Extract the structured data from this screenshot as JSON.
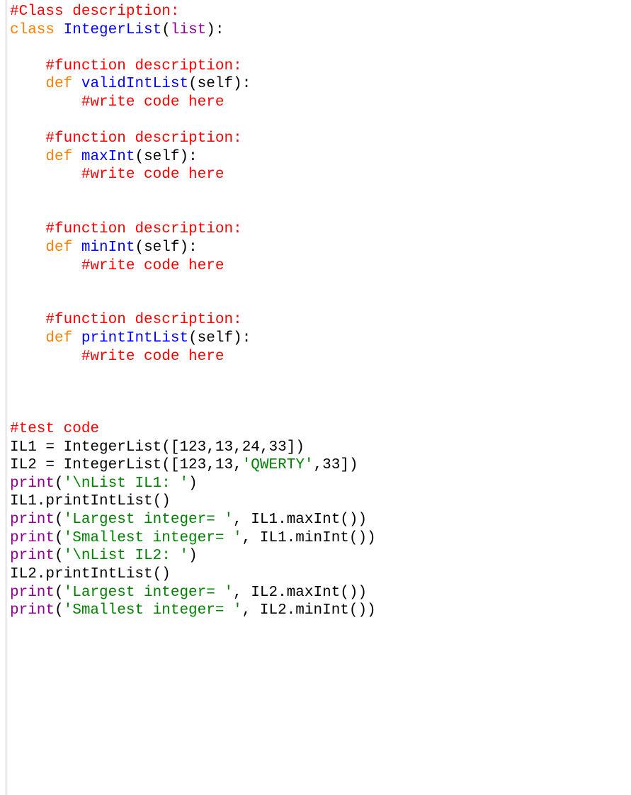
{
  "lines": [
    {
      "tokens": [
        {
          "cls": "c-red",
          "t": "#Class description:"
        }
      ]
    },
    {
      "tokens": [
        {
          "cls": "c-orange",
          "t": "class"
        },
        {
          "cls": "c-black",
          "t": " "
        },
        {
          "cls": "c-blue",
          "t": "IntegerList"
        },
        {
          "cls": "c-black",
          "t": "("
        },
        {
          "cls": "c-purple",
          "t": "list"
        },
        {
          "cls": "c-black",
          "t": "):"
        }
      ]
    },
    {
      "tokens": [
        {
          "cls": "c-black",
          "t": ""
        }
      ]
    },
    {
      "tokens": [
        {
          "cls": "c-black",
          "t": "    "
        },
        {
          "cls": "c-red",
          "t": "#function description:"
        }
      ]
    },
    {
      "tokens": [
        {
          "cls": "c-black",
          "t": "    "
        },
        {
          "cls": "c-orange",
          "t": "def"
        },
        {
          "cls": "c-black",
          "t": " "
        },
        {
          "cls": "c-blue",
          "t": "validIntList"
        },
        {
          "cls": "c-black",
          "t": "(self):"
        }
      ]
    },
    {
      "tokens": [
        {
          "cls": "c-black",
          "t": "        "
        },
        {
          "cls": "c-red",
          "t": "#write code here"
        }
      ]
    },
    {
      "tokens": [
        {
          "cls": "c-black",
          "t": ""
        }
      ]
    },
    {
      "tokens": [
        {
          "cls": "c-black",
          "t": "    "
        },
        {
          "cls": "c-red",
          "t": "#function description:"
        }
      ]
    },
    {
      "tokens": [
        {
          "cls": "c-black",
          "t": "    "
        },
        {
          "cls": "c-orange",
          "t": "def"
        },
        {
          "cls": "c-black",
          "t": " "
        },
        {
          "cls": "c-blue",
          "t": "maxInt"
        },
        {
          "cls": "c-black",
          "t": "(self):"
        }
      ]
    },
    {
      "tokens": [
        {
          "cls": "c-black",
          "t": "        "
        },
        {
          "cls": "c-red",
          "t": "#write code here"
        }
      ]
    },
    {
      "tokens": [
        {
          "cls": "c-black",
          "t": ""
        }
      ]
    },
    {
      "tokens": [
        {
          "cls": "c-black",
          "t": ""
        }
      ]
    },
    {
      "tokens": [
        {
          "cls": "c-black",
          "t": "    "
        },
        {
          "cls": "c-red",
          "t": "#function description:"
        }
      ]
    },
    {
      "tokens": [
        {
          "cls": "c-black",
          "t": "    "
        },
        {
          "cls": "c-orange",
          "t": "def"
        },
        {
          "cls": "c-black",
          "t": " "
        },
        {
          "cls": "c-blue",
          "t": "minInt"
        },
        {
          "cls": "c-black",
          "t": "(self):"
        }
      ]
    },
    {
      "tokens": [
        {
          "cls": "c-black",
          "t": "        "
        },
        {
          "cls": "c-red",
          "t": "#write code here"
        }
      ]
    },
    {
      "tokens": [
        {
          "cls": "c-black",
          "t": ""
        }
      ]
    },
    {
      "tokens": [
        {
          "cls": "c-black",
          "t": ""
        }
      ]
    },
    {
      "tokens": [
        {
          "cls": "c-black",
          "t": "    "
        },
        {
          "cls": "c-red",
          "t": "#function description:"
        }
      ]
    },
    {
      "tokens": [
        {
          "cls": "c-black",
          "t": "    "
        },
        {
          "cls": "c-orange",
          "t": "def"
        },
        {
          "cls": "c-black",
          "t": " "
        },
        {
          "cls": "c-blue",
          "t": "printIntList"
        },
        {
          "cls": "c-black",
          "t": "(self):"
        }
      ]
    },
    {
      "tokens": [
        {
          "cls": "c-black",
          "t": "        "
        },
        {
          "cls": "c-red",
          "t": "#write code here"
        }
      ]
    },
    {
      "tokens": [
        {
          "cls": "c-black",
          "t": ""
        }
      ]
    },
    {
      "tokens": [
        {
          "cls": "c-black",
          "t": ""
        }
      ]
    },
    {
      "tokens": [
        {
          "cls": "c-black",
          "t": ""
        }
      ]
    },
    {
      "tokens": [
        {
          "cls": "c-red",
          "t": "#test code"
        }
      ]
    },
    {
      "tokens": [
        {
          "cls": "c-black",
          "t": "IL1 = IntegerList(["
        },
        {
          "cls": "c-black",
          "t": "123"
        },
        {
          "cls": "c-black",
          "t": ","
        },
        {
          "cls": "c-black",
          "t": "13"
        },
        {
          "cls": "c-black",
          "t": ","
        },
        {
          "cls": "c-black",
          "t": "24"
        },
        {
          "cls": "c-black",
          "t": ","
        },
        {
          "cls": "c-black",
          "t": "33"
        },
        {
          "cls": "c-black",
          "t": "])"
        }
      ]
    },
    {
      "tokens": [
        {
          "cls": "c-black",
          "t": "IL2 = IntegerList(["
        },
        {
          "cls": "c-black",
          "t": "123"
        },
        {
          "cls": "c-black",
          "t": ","
        },
        {
          "cls": "c-black",
          "t": "13"
        },
        {
          "cls": "c-black",
          "t": ","
        },
        {
          "cls": "c-green",
          "t": "'QWERTY'"
        },
        {
          "cls": "c-black",
          "t": ","
        },
        {
          "cls": "c-black",
          "t": "33"
        },
        {
          "cls": "c-black",
          "t": "])"
        }
      ]
    },
    {
      "tokens": [
        {
          "cls": "c-purple",
          "t": "print"
        },
        {
          "cls": "c-black",
          "t": "("
        },
        {
          "cls": "c-green",
          "t": "'\\nList IL1: '"
        },
        {
          "cls": "c-black",
          "t": ")"
        }
      ]
    },
    {
      "tokens": [
        {
          "cls": "c-black",
          "t": "IL1.printIntList()"
        }
      ]
    },
    {
      "tokens": [
        {
          "cls": "c-purple",
          "t": "print"
        },
        {
          "cls": "c-black",
          "t": "("
        },
        {
          "cls": "c-green",
          "t": "'Largest integer= '"
        },
        {
          "cls": "c-black",
          "t": ", IL1.maxInt())"
        }
      ]
    },
    {
      "tokens": [
        {
          "cls": "c-purple",
          "t": "print"
        },
        {
          "cls": "c-black",
          "t": "("
        },
        {
          "cls": "c-green",
          "t": "'Smallest integer= '"
        },
        {
          "cls": "c-black",
          "t": ", IL1.minInt())"
        }
      ]
    },
    {
      "tokens": [
        {
          "cls": "c-purple",
          "t": "print"
        },
        {
          "cls": "c-black",
          "t": "("
        },
        {
          "cls": "c-green",
          "t": "'\\nList IL2: '"
        },
        {
          "cls": "c-black",
          "t": ")"
        }
      ]
    },
    {
      "tokens": [
        {
          "cls": "c-black",
          "t": "IL2.printIntList()"
        }
      ]
    },
    {
      "tokens": [
        {
          "cls": "c-purple",
          "t": "print"
        },
        {
          "cls": "c-black",
          "t": "("
        },
        {
          "cls": "c-green",
          "t": "'Largest integer= '"
        },
        {
          "cls": "c-black",
          "t": ", IL2.maxInt())"
        }
      ]
    },
    {
      "tokens": [
        {
          "cls": "c-purple",
          "t": "print"
        },
        {
          "cls": "c-black",
          "t": "("
        },
        {
          "cls": "c-green",
          "t": "'Smallest integer= '"
        },
        {
          "cls": "c-black",
          "t": ", IL2.minInt())"
        }
      ]
    }
  ]
}
